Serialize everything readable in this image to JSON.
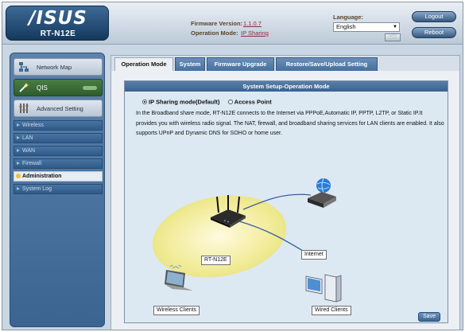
{
  "header": {
    "logo": "/ISUS",
    "model": "RT-N12E",
    "firmware_label": "Firmware Version:",
    "firmware_value": "1.1.0.7",
    "opmode_label": "Operation Mode:",
    "opmode_value": "IP Sharing",
    "language_label": "Language:",
    "language_value": "English",
    "ok_label": "OK",
    "logout_label": "Logout",
    "reboot_label": "Reboot"
  },
  "sidebar": {
    "network_map": "Network Map",
    "qis": "QIS",
    "advanced": "Advanced Setting",
    "sub_items": [
      "Wireless",
      "LAN",
      "WAN",
      "Firewall",
      "Administration",
      "System Log"
    ],
    "active_index": 4
  },
  "tabs": [
    "Operation Mode",
    "System",
    "Firmware Upgrade",
    "Restore/Save/Upload Setting"
  ],
  "panel": {
    "title": "System Setup-Operation Mode",
    "radio_ip_sharing": "IP Sharing mode(Default)",
    "radio_access_point": "Access Point",
    "description": "In the Broadband share mode, RT-N12E connects to the Internet via PPPoE,Automatic IP, PPTP, L2TP, or Static IP.It provides you with wireless radio signal. The NAT, firewall, and broadband sharing services for LAN clients are enabled. It also supports UPnP and Dynamic DNS for SOHO or home user.",
    "diagram": {
      "router": "RT-N12E",
      "internet": "Internet",
      "wireless_clients": "Wireless Clients",
      "wired_clients": "Wired Clients"
    },
    "save_label": "Save"
  },
  "colors": {
    "sidebar_bg": "#3b6491",
    "qis_bg": "#2f5c2d",
    "accent_link": "#8c2d3c"
  }
}
